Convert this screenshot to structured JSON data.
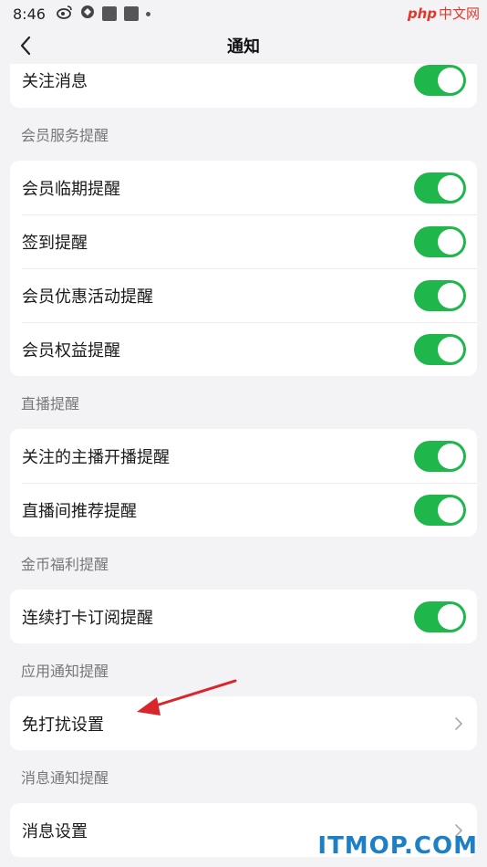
{
  "status_bar": {
    "time": "8:46",
    "watermark_logo": "php",
    "watermark_text": "中文网"
  },
  "header": {
    "title": "通知"
  },
  "top_card": {
    "rows": [
      {
        "label": "关注消息",
        "toggle": true
      }
    ]
  },
  "sections": [
    {
      "header": "会员服务提醒",
      "rows": [
        {
          "label": "会员临期提醒",
          "toggle": true
        },
        {
          "label": "签到提醒",
          "toggle": true
        },
        {
          "label": "会员优惠活动提醒",
          "toggle": true
        },
        {
          "label": "会员权益提醒",
          "toggle": true
        }
      ]
    },
    {
      "header": "直播提醒",
      "rows": [
        {
          "label": "关注的主播开播提醒",
          "toggle": true
        },
        {
          "label": "直播间推荐提醒",
          "toggle": true
        }
      ]
    },
    {
      "header": "金币福利提醒",
      "rows": [
        {
          "label": "连续打卡订阅提醒",
          "toggle": true
        }
      ]
    },
    {
      "header": "应用通知提醒",
      "rows": [
        {
          "label": "免打扰设置",
          "link": true
        }
      ]
    },
    {
      "header": "消息通知提醒",
      "rows": [
        {
          "label": "消息设置",
          "link": true
        }
      ]
    }
  ],
  "footer_watermark": "ITMOP.COM",
  "colors": {
    "toggle_on": "#1fb64c",
    "background": "#f3f3f6",
    "annotation_arrow": "#d9262b"
  }
}
